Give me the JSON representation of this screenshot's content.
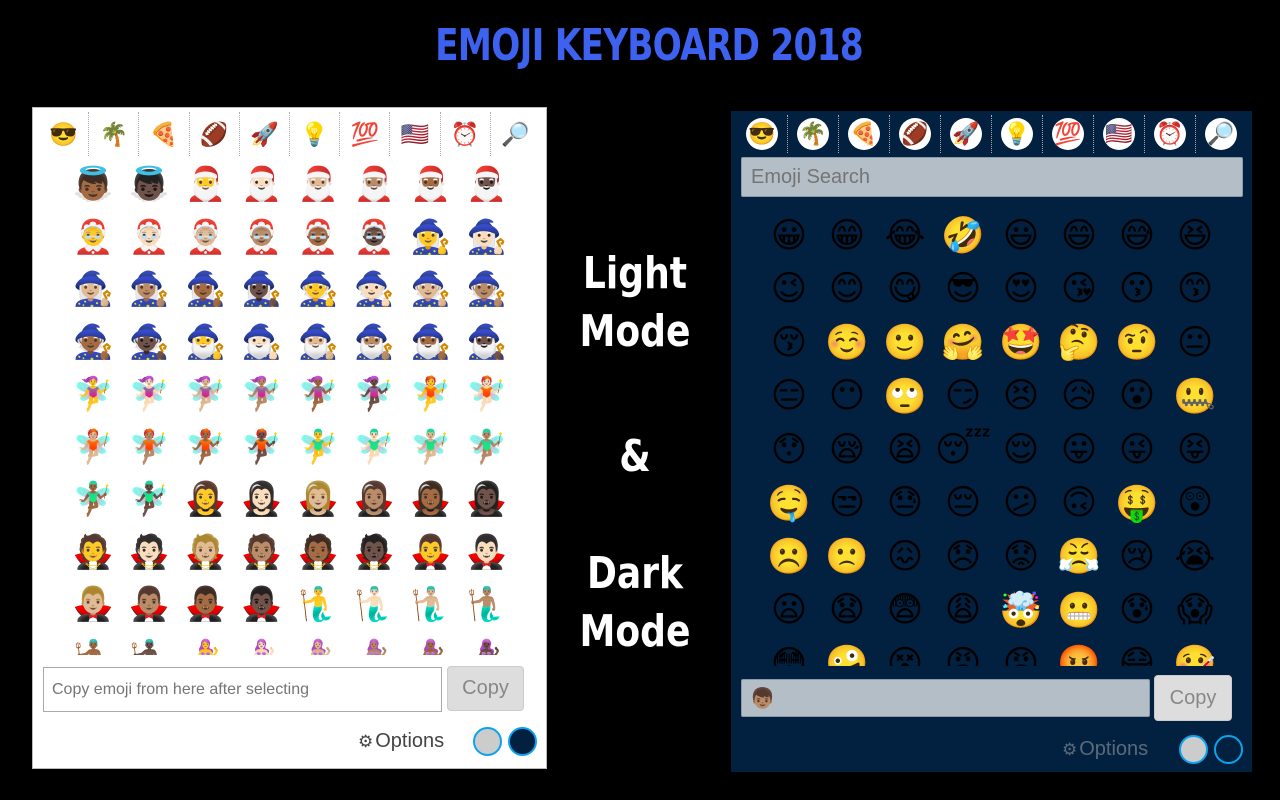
{
  "header": {
    "title": "EMOJI KEYBOARD 2018"
  },
  "labels": {
    "light_line1": "Light",
    "light_line2": "Mode",
    "amp": "&",
    "dark_line1": "Dark",
    "dark_line2": "Mode"
  },
  "colors": {
    "title": "#3e62f0",
    "dark_bg": "#02203f",
    "accent_ring": "#0aa3ec"
  },
  "category_tabs": [
    {
      "name": "smileys",
      "icon": "😎"
    },
    {
      "name": "nature",
      "icon": "🌴"
    },
    {
      "name": "food",
      "icon": "🍕"
    },
    {
      "name": "activity",
      "icon": "🏈"
    },
    {
      "name": "travel",
      "icon": "🚀"
    },
    {
      "name": "objects",
      "icon": "💡"
    },
    {
      "name": "symbols",
      "icon": "💯"
    },
    {
      "name": "flags",
      "icon": "🇺🇸"
    },
    {
      "name": "recent",
      "icon": "⏰"
    },
    {
      "name": "search",
      "icon": "🔎"
    }
  ],
  "light_panel": {
    "emojis": [
      "👼🏾",
      "👼🏿",
      "🎅",
      "🎅🏻",
      "🎅🏼",
      "🎅🏽",
      "🎅🏾",
      "🎅🏿",
      "🤶",
      "🤶🏻",
      "🤶🏼",
      "🤶🏽",
      "🤶🏾",
      "🤶🏿",
      "🧙‍♀️",
      "🧙🏻‍♀️",
      "🧙🏼‍♀️",
      "🧙🏽‍♀️",
      "🧙🏾‍♀️",
      "🧙🏿‍♀️",
      "🧙",
      "🧙🏻",
      "🧙🏼",
      "🧙🏽",
      "🧙🏾",
      "🧙🏿",
      "🧙‍♂️",
      "🧙🏻‍♂️",
      "🧙🏼‍♂️",
      "🧙🏽‍♂️",
      "🧙🏾‍♂️",
      "🧙🏿‍♂️",
      "🧚‍♀️",
      "🧚🏻‍♀️",
      "🧚🏼‍♀️",
      "🧚🏽‍♀️",
      "🧚🏾‍♀️",
      "🧚🏿‍♀️",
      "🧚",
      "🧚🏻",
      "🧚🏼",
      "🧚🏽",
      "🧚🏾",
      "🧚🏿",
      "🧚‍♂️",
      "🧚🏻‍♂️",
      "🧚🏼‍♂️",
      "🧚🏽‍♂️",
      "🧚🏾‍♂️",
      "🧚🏿‍♂️",
      "🧛‍♀️",
      "🧛🏻‍♀️",
      "🧛🏼‍♀️",
      "🧛🏽‍♀️",
      "🧛🏾‍♀️",
      "🧛🏿‍♀️",
      "🧛",
      "🧛🏻",
      "🧛🏼",
      "🧛🏽",
      "🧛🏾",
      "🧛🏿",
      "🧛‍♂️",
      "🧛🏻‍♂️",
      "🧛🏼‍♂️",
      "🧛🏽‍♂️",
      "🧛🏾‍♂️",
      "🧛🏿‍♂️",
      "🧜‍♂️",
      "🧜🏻‍♂️",
      "🧜🏼‍♂️",
      "🧜🏽‍♂️",
      "🧜🏾‍♂️",
      "🧜🏿‍♂️",
      "🧜‍♀️",
      "🧜🏻‍♀️",
      "🧜🏼‍♀️",
      "🧜🏽‍♀️",
      "🧜🏾‍♀️",
      "🧜🏿‍♀️"
    ],
    "copy_placeholder": "Copy emoji from here after selecting",
    "copy_value": "",
    "copy_button": "Copy",
    "options_label": "Options"
  },
  "dark_panel": {
    "search_placeholder": "Emoji Search",
    "emojis": [
      "😀",
      "😁",
      "😂",
      "🤣",
      "😃",
      "😄",
      "😅",
      "😆",
      "😉",
      "😊",
      "😋",
      "😎",
      "😍",
      "😘",
      "😗",
      "😙",
      "😚",
      "☺️",
      "🙂",
      "🤗",
      "🤩",
      "🤔",
      "🤨",
      "😐",
      "😑",
      "😶",
      "🙄",
      "😏",
      "😣",
      "😥",
      "😮",
      "🤐",
      "😯",
      "😪",
      "😫",
      "😴",
      "😌",
      "😛",
      "😜",
      "😝",
      "🤤",
      "😒",
      "😓",
      "😔",
      "😕",
      "🙃",
      "🤑",
      "😲",
      "☹️",
      "🙁",
      "😖",
      "😞",
      "😟",
      "😤",
      "😢",
      "😭",
      "😦",
      "😧",
      "😨",
      "😩",
      "🤯",
      "😬",
      "😰",
      "😱",
      "😳",
      "🤪",
      "😵",
      "😡",
      "😠",
      "🤬",
      "😷",
      "🤒"
    ],
    "copy_value": "👦🏽",
    "copy_button": "Copy",
    "options_label": "Options"
  }
}
